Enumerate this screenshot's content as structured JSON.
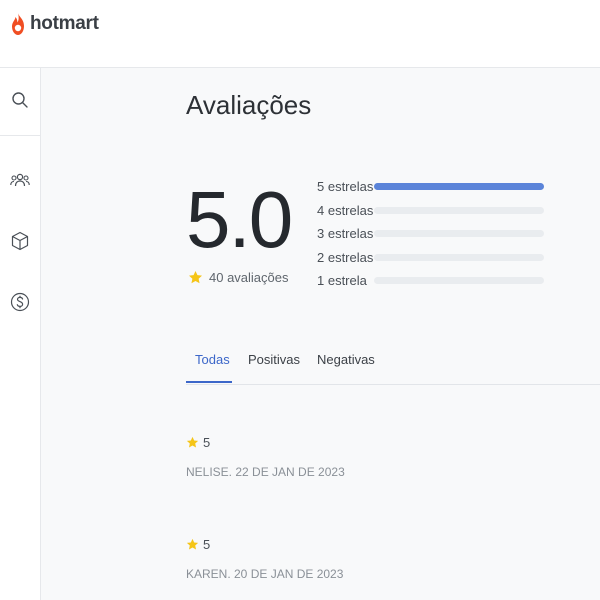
{
  "brand": {
    "name": "hotmart",
    "color": "#f04e23"
  },
  "sidebar": {
    "items": [
      {
        "icon": "search-icon"
      },
      {
        "icon": "users-icon"
      },
      {
        "icon": "box-icon"
      },
      {
        "icon": "dollar-icon"
      }
    ]
  },
  "ratings": {
    "title": "Avaliações",
    "score": "5.0",
    "count_label": "40 avaliações",
    "distribution": [
      {
        "label": "5 estrelas",
        "fraction": 1.0
      },
      {
        "label": "4 estrelas",
        "fraction": 0
      },
      {
        "label": "3 estrelas",
        "fraction": 0
      },
      {
        "label": "2 estrelas",
        "fraction": 0
      },
      {
        "label": "1 estrela",
        "fraction": 0
      }
    ]
  },
  "tabs": [
    {
      "label": "Todas",
      "active": true
    },
    {
      "label": "Positivas",
      "active": false
    },
    {
      "label": "Negativas",
      "active": false
    }
  ],
  "reviews": [
    {
      "rating": "5",
      "meta": "NELISE. 22 DE JAN DE 2023"
    },
    {
      "rating": "5",
      "meta": "KAREN. 20 DE JAN DE 2023"
    }
  ],
  "colors": {
    "accent": "#3c67c9",
    "bar_fill": "#5b84d9",
    "star": "#f5c518"
  }
}
